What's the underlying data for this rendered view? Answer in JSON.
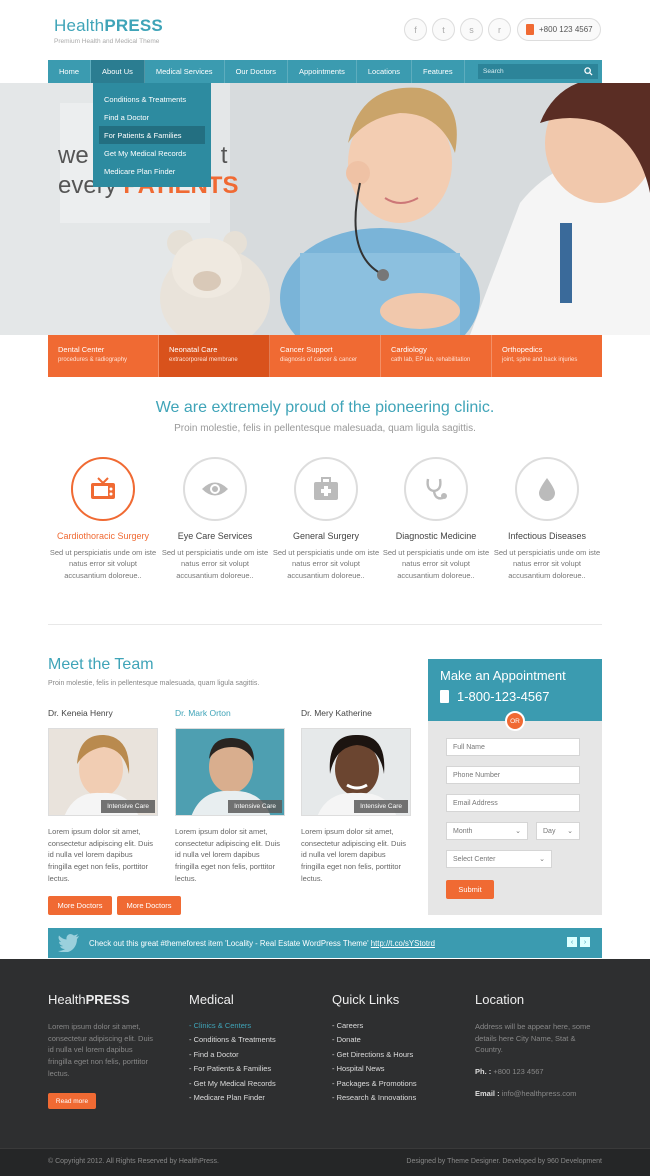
{
  "logo": {
    "name_plain": "Health",
    "name_bold": "PRESS",
    "tagline": "Premium Health and Medical Theme"
  },
  "header": {
    "phone": "+800 123 4567",
    "social": [
      "f",
      "t",
      "s",
      "r"
    ]
  },
  "nav": {
    "items": [
      "Home",
      "About Us",
      "Medical Services",
      "Our Doctors",
      "Appointments",
      "Locations",
      "Features"
    ],
    "search_placeholder": "Search"
  },
  "dropdown": {
    "items": [
      "Conditions & Treatments",
      "Find a Doctor",
      "For Patients & Families",
      "Get My Medical Records",
      "Medicare Plan Finder"
    ]
  },
  "hero": {
    "line1": "we",
    "line1_end": "t",
    "line2_plain": "every",
    "line2_bold": "PATIENTS"
  },
  "services": [
    {
      "title": "Dental Center",
      "sub": "procedures & radiography"
    },
    {
      "title": "Neonatal Care",
      "sub": "extracorporeal membrane"
    },
    {
      "title": "Cancer Support",
      "sub": "diagnosis of cancer & cancer"
    },
    {
      "title": "Cardiology",
      "sub": "cath lab, EP lab, rehabilitation"
    },
    {
      "title": "Orthopedics",
      "sub": "joint, spine and back injuries"
    }
  ],
  "intro": {
    "title": "We are extremely proud of the pioneering clinic.",
    "subtitle": "Proin molestie, felis in pellentesque malesuada, quam ligula sagittis."
  },
  "features": [
    {
      "title": "Cardiothoracic Surgery",
      "icon": "tv-icon",
      "desc": "Sed ut perspiciatis unde om iste natus error sit volupt accusantium doloreue.."
    },
    {
      "title": "Eye Care Services",
      "icon": "eye-icon",
      "desc": "Sed ut perspiciatis unde om iste natus error sit volupt accusantium doloreue.."
    },
    {
      "title": "General Surgery",
      "icon": "medkit-icon",
      "desc": "Sed ut perspiciatis unde om iste natus error sit volupt accusantium doloreue.."
    },
    {
      "title": "Diagnostic Medicine",
      "icon": "stethoscope-icon",
      "desc": "Sed ut perspiciatis unde om iste natus error sit volupt accusantium doloreue.."
    },
    {
      "title": "Infectious Diseases",
      "icon": "drop-icon",
      "desc": "Sed ut perspiciatis unde om iste natus error sit volupt accusantium doloreue.."
    }
  ],
  "team": {
    "title": "Meet the Team",
    "subtitle": "Proin molestie, felis in pellentesque malesuada, quam ligula sagittis.",
    "doctors": [
      {
        "name": "Dr. Keneia Henry",
        "badge": "Intensive Care",
        "text": "Lorem ipsum dolor sit amet, consectetur adipiscing elit. Duis id nulla vel lorem dapibus fringilla eget non felis, porttitor lectus."
      },
      {
        "name": "Dr. Mark Orton",
        "badge": "Intensive Care",
        "text": "Lorem ipsum dolor sit amet, consectetur adipiscing elit. Duis id nulla vel lorem dapibus fringilla eget non felis, porttitor lectus."
      },
      {
        "name": "Dr. Mery Katherine",
        "badge": "Intensive Care",
        "text": "Lorem ipsum dolor sit amet, consectetur adipiscing elit. Duis id nulla vel lorem dapibus fringilla eget non felis, porttitor lectus."
      }
    ],
    "more_label": "More Doctors"
  },
  "appointment": {
    "title": "Make an Appointment",
    "phone": "1-800-123-4567",
    "or": "OR",
    "full_name": "Full Name",
    "phone_field": "Phone Number",
    "email": "Email Address",
    "month": "Month",
    "day": "Day",
    "center": "Select Center",
    "submit": "Submit"
  },
  "twitter": {
    "text": "Check out this great #themeforest item 'Locality - Real Estate WordPress Theme'",
    "link": "http://t.co/sYStotrd"
  },
  "footer": {
    "about": {
      "title_plain": "Health",
      "title_bold": "PRESS",
      "text": "Lorem ipsum dolor sit amet, consectetur adipiscing elit. Duis id nulla vel lorem dapibus fringilla eget non felis, porttitor lectus.",
      "button": "Read more"
    },
    "medical": {
      "title": "Medical",
      "links": [
        "Clinics & Centers",
        "Conditions & Treatments",
        "Find a Doctor",
        "For Patients & Families",
        "Get My Medical Records",
        "Medicare Plan Finder"
      ]
    },
    "quick": {
      "title": "Quick Links",
      "links": [
        "Careers",
        "Donate",
        "Get Directions & Hours",
        "Hospital News",
        "Packages & Promotions",
        "Research & Innovations"
      ]
    },
    "location": {
      "title": "Location",
      "address": "Address will be appear here, some details here City Name, Stat & Country.",
      "phone_label": "Ph. :",
      "phone": "+800 123 4567",
      "email_label": "Email :",
      "email": "info@healthpress.com"
    },
    "copyright": "© Copyright 2012. All Rights Reserved by HealthPress.",
    "credits": "Designed by Theme Designer. Developed by 960 Development"
  },
  "colors": {
    "teal": "#3b9bb0",
    "orange": "#f06a33",
    "dark": "#2e2f30"
  }
}
